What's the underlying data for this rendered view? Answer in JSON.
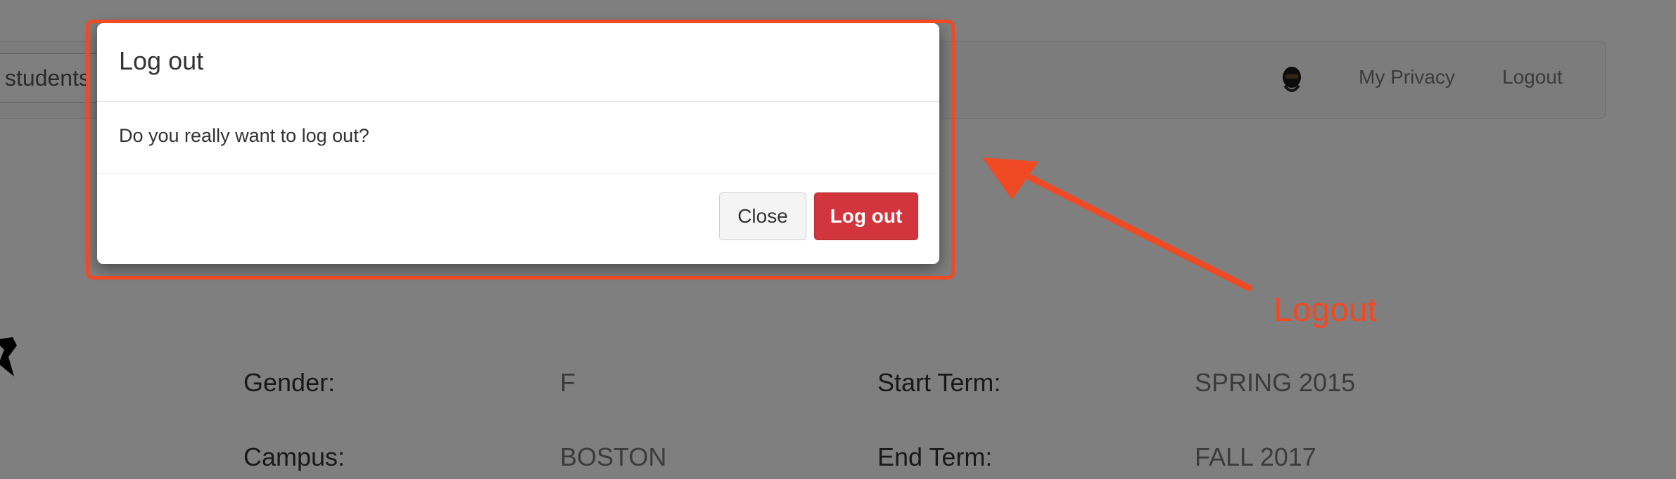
{
  "navbar": {
    "search_text": "students",
    "links": [
      "My Privacy",
      "Logout"
    ]
  },
  "profile": {
    "rows": [
      {
        "label": "Gender:",
        "value": "F",
        "label2": "Start Term:",
        "value2": "SPRING 2015"
      },
      {
        "label": "Campus:",
        "value": "BOSTON",
        "label2": "End Term:",
        "value2": "FALL 2017"
      }
    ]
  },
  "modal": {
    "title": "Log out",
    "message": "Do you really want to log out?",
    "close_label": "Close",
    "confirm_label": "Log out"
  },
  "annotation": {
    "label": "Logout",
    "color": "#f04a24"
  },
  "colors": {
    "danger": "#d2353d",
    "backdrop": "rgba(0,0,0,0.5)"
  }
}
